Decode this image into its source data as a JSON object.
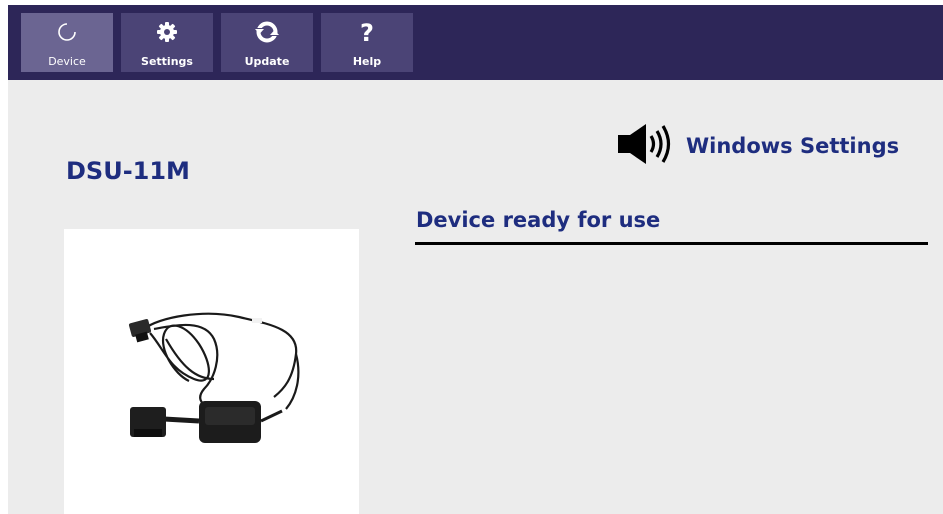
{
  "toolbar": {
    "buttons": [
      {
        "label": "Device",
        "icon": "refresh-spinner-icon",
        "active": true
      },
      {
        "label": "Settings",
        "icon": "gear-icon",
        "active": false
      },
      {
        "label": "Update",
        "icon": "sync-icon",
        "active": false
      },
      {
        "label": "Help",
        "icon": "question-icon",
        "active": false
      }
    ],
    "background_color": "#2d2658",
    "button_color": "#4b4476",
    "active_button_color": "#6b6592"
  },
  "device": {
    "name": "DSU-11M",
    "image": "usb-cable-product-photo"
  },
  "windows_settings": {
    "label": "Windows Settings",
    "icon": "speaker-icon"
  },
  "status": {
    "text": "Device ready for use"
  },
  "colors": {
    "heading": "#1e2d7f",
    "page_background": "#ececec"
  }
}
